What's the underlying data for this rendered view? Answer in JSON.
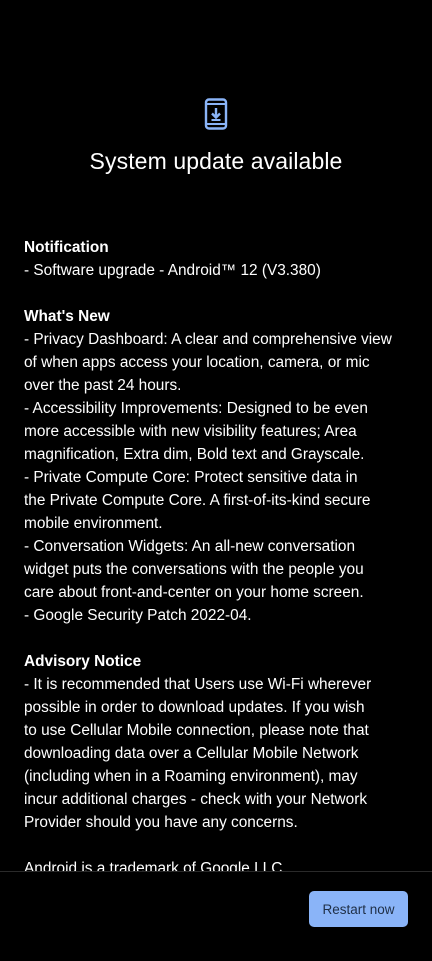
{
  "icon": {
    "name": "system-update-icon",
    "color": "#8ab4f8"
  },
  "title": "System update available",
  "sections": {
    "notification": {
      "heading": "Notification",
      "lines": [
        "- Software upgrade - Android™ 12 (V3.380)"
      ]
    },
    "whats_new": {
      "heading": "What's New",
      "lines": [
        "- Privacy Dashboard: A clear and comprehensive view",
        "of when apps access your location, camera, or mic",
        "over the past 24 hours.",
        "- Accessibility Improvements: Designed to be even",
        "more accessible with new visibility features; Area",
        "magnification, Extra dim, Bold text and Grayscale.",
        "- Private Compute Core: Protect sensitive data in",
        "the Private Compute Core. A first-of-its-kind secure",
        "mobile environment.",
        "- Conversation Widgets: An all-new conversation",
        "widget puts the conversations with the people you",
        "care about front-and-center on your home screen.",
        "- Google Security Patch 2022-04."
      ]
    },
    "advisory": {
      "heading": "Advisory Notice",
      "lines": [
        "- It is recommended that Users use Wi-Fi wherever",
        "possible in order to download updates. If you wish",
        "to use Cellular Mobile connection, please note that",
        "downloading data over a Cellular Mobile Network",
        "(including when in a Roaming environment), may",
        "incur additional charges - check with your Network",
        "Provider should you have any concerns."
      ]
    },
    "trademark": {
      "lines": [
        "Android is a trademark of Google LLC."
      ]
    }
  },
  "footer": {
    "restart_label": "Restart now",
    "button_color": "#8ab4f8"
  }
}
